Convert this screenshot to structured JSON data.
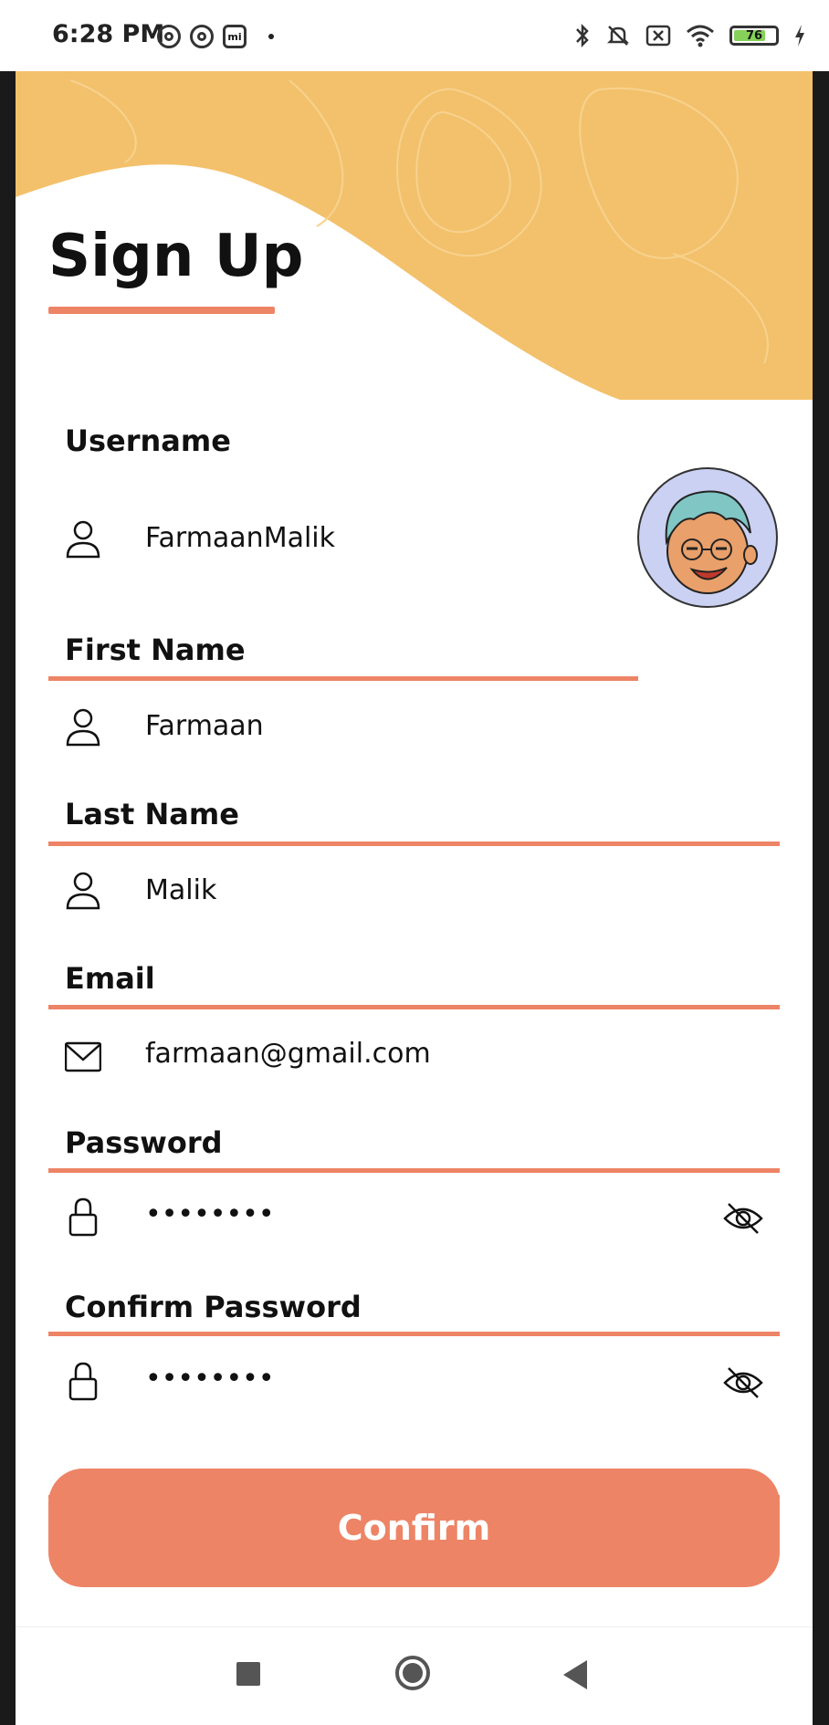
{
  "status_bar": {
    "time": "6:28 PM",
    "mi_badge": "mi",
    "battery_level": "76",
    "icons_left": [
      "at-circle-icon",
      "at-circle-icon",
      "mi-icon",
      "dot-icon"
    ],
    "icons_right": [
      "bluetooth-icon",
      "mute-icon",
      "no-sim-icon",
      "wifi-icon",
      "battery-icon",
      "charging-icon"
    ]
  },
  "page": {
    "title": "Sign Up"
  },
  "form": {
    "username": {
      "label": "Username",
      "value": "FarmaanMalik",
      "icon": "person-icon"
    },
    "first_name": {
      "label": "First Name",
      "value": "Farmaan",
      "icon": "person-icon"
    },
    "last_name": {
      "label": "Last Name",
      "value": "Malik",
      "icon": "person-icon"
    },
    "email": {
      "label": "Email",
      "value": "farmaan@gmail.com",
      "icon": "mail-icon"
    },
    "password": {
      "label": "Password",
      "value": "••••••••",
      "icon": "lock-icon",
      "toggle_icon": "eye-off-icon"
    },
    "confirm_password": {
      "label": "Confirm Password",
      "value": "••••••••",
      "icon": "lock-icon",
      "toggle_icon": "eye-off-icon"
    }
  },
  "actions": {
    "confirm_label": "Confirm"
  },
  "colors": {
    "accent": "#ed8466",
    "header_wave": "#f3c16b",
    "avatar_bg": "#cbd1f2"
  },
  "nav_bar": {
    "buttons": [
      "recents-icon",
      "home-icon",
      "back-icon"
    ]
  }
}
